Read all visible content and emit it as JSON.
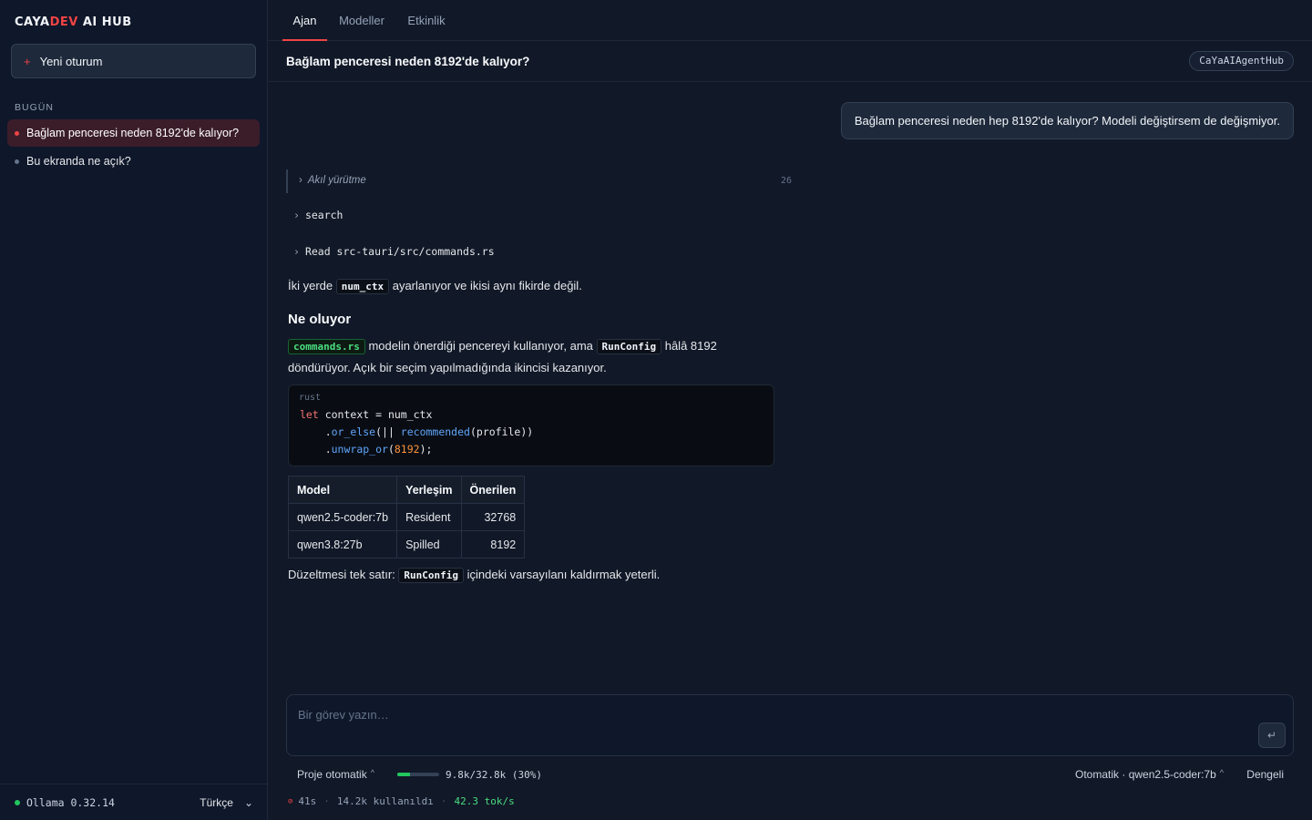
{
  "sidebar": {
    "brand_a": "CAYA",
    "brand_b": "DEV",
    "brand_c": " AI HUB",
    "new_session": "Yeni oturum",
    "section": "BUGÜN",
    "items": [
      {
        "label": "Bağlam penceresi neden 8192'de kalıyor?"
      },
      {
        "label": "Bu ekranda ne açık?"
      }
    ],
    "ollama": "Ollama 0.32.14",
    "language": "Türkçe"
  },
  "tabs": [
    {
      "label": "Ajan"
    },
    {
      "label": "Modeller"
    },
    {
      "label": "Etkinlik"
    }
  ],
  "header": {
    "title": "Bağlam penceresi neden 8192'de kalıyor?",
    "agent": "CaYaAIAgentHub"
  },
  "chat": {
    "user_message": "Bağlam penceresi neden hep 8192'de kalıyor? Modeli değiştirsem de değişmiyor.",
    "reasoning_label": "Akıl yürütme",
    "reasoning_count": "26",
    "tool1": "search",
    "tool2": "Read src-tauri/src/commands.rs",
    "p1_pre": "İki yerde ",
    "p1_code": "num_ctx",
    "p1_post": " ayarlanıyor ve ikisi aynı fikirde değil.",
    "heading": "Ne oluyor",
    "p2_code1": "commands.rs",
    "p2_mid": " modelin önerdiği pencereyi kullanıyor, ama ",
    "p2_code2": "RunConfig",
    "p2_post1": " hâlâ 8192",
    "p2_post2": "döndürüyor. Açık bir seçim yapılmadığında ikincisi kazanıyor.",
    "code_lang": "rust",
    "code": {
      "l1_kw": "let",
      "l1_rest": " context = num_ctx",
      "l2_pre": "    .",
      "l2_fn": "or_else",
      "l2_mid": "(|| ",
      "l2_fn2": "recommended",
      "l2_post": "(profile))",
      "l3_pre": "    .",
      "l3_fn": "unwrap_or",
      "l3_mid": "(",
      "l3_num": "8192",
      "l3_post": ");"
    },
    "table": {
      "headers": [
        "Model",
        "Yerleşim",
        "Önerilen"
      ],
      "rows": [
        [
          "qwen2.5-coder:7b",
          "Resident",
          "32768"
        ],
        [
          "qwen3.8:27b",
          "Spilled",
          "8192"
        ]
      ]
    },
    "p3_pre": "Düzeltmesi tek satır: ",
    "p3_code": "RunConfig",
    "p3_post": " içindeki varsayılanı kaldırmak yeterli."
  },
  "composer": {
    "placeholder": "Bir görev yazın…",
    "send_icon": "↵"
  },
  "status": {
    "project": "Proje otomatik",
    "context_text": "9.8k/32.8k (30%)",
    "context_fraction": 0.3,
    "model": "Otomatik · qwen2.5-coder:7b",
    "preset": "Dengeli",
    "elapsed": "41s",
    "used": "14.2k kullanıldı",
    "speed": "42.3 tok/s"
  },
  "colors": {
    "accent": "#ef4444",
    "success": "#22c55e",
    "background": "#111827"
  }
}
